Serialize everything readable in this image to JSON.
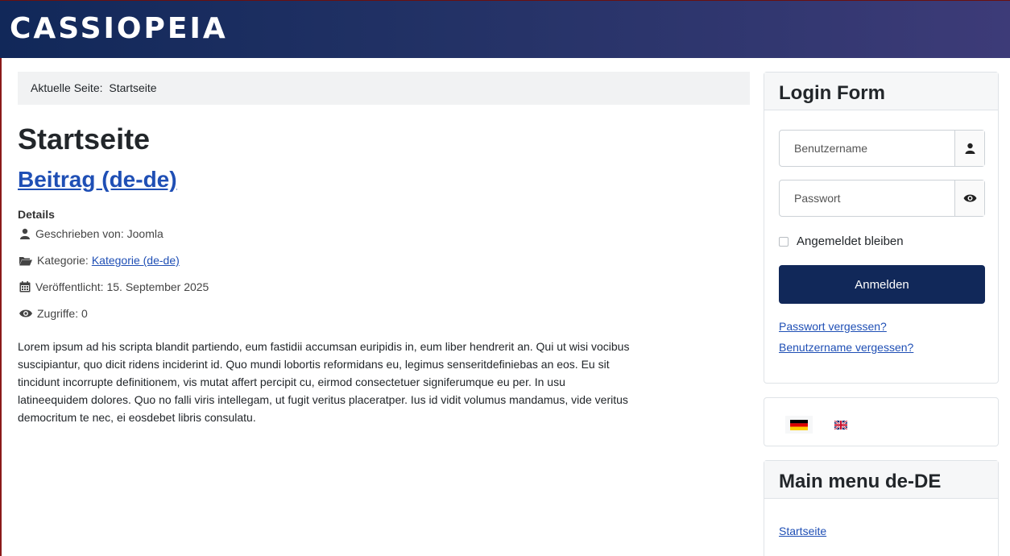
{
  "header": {
    "logo": "CASSIOPEIA"
  },
  "breadcrumb": {
    "label": "Aktuelle Seite:",
    "current": "Startseite"
  },
  "main": {
    "page_title": "Startseite",
    "article_title": "Beitrag (de-de)",
    "details_label": "Details",
    "meta": {
      "author": "Geschrieben von: Joomla",
      "category_label": "Kategorie:",
      "category_link": "Kategorie (de-de)",
      "published": "Veröffentlicht: 15. September 2025",
      "hits": "Zugriffe: 0"
    },
    "body_lines": [
      "Lorem ipsum ad his scripta blandit partiendo, eum fastidii accumsan euripidis in, eum liber hendrerit an. Qui ut wisi vocibus",
      "suscipiantur, quo dicit ridens inciderint id. Quo mundi lobortis reformidans eu, legimus senseritdefiniebas an eos. Eu sit",
      "tincidunt incorrupte definitionem, vis mutat affert percipit cu, eirmod consectetuer signiferumque eu per. In usu",
      "latineequidem dolores. Quo no falli viris intellegam, ut fugit veritus placeratper. Ius id vidit volumus mandamus, vide veritus",
      "democritum te nec, ei eosdebet libris consulatu."
    ]
  },
  "login": {
    "title": "Login Form",
    "username_placeholder": "Benutzername",
    "password_placeholder": "Passwort",
    "remember_label": "Angemeldet bleiben",
    "submit_label": "Anmelden",
    "forgot_password": "Passwort vergessen?",
    "forgot_username": "Benutzername vergessen?"
  },
  "languages": {
    "items": [
      "de-DE",
      "en-GB"
    ]
  },
  "menu": {
    "title": "Main menu de-DE",
    "items": [
      "Startseite"
    ]
  },
  "colors": {
    "header_start": "#112859",
    "header_end": "#3d3b78",
    "link": "#1f4fb5",
    "button": "#112859"
  }
}
